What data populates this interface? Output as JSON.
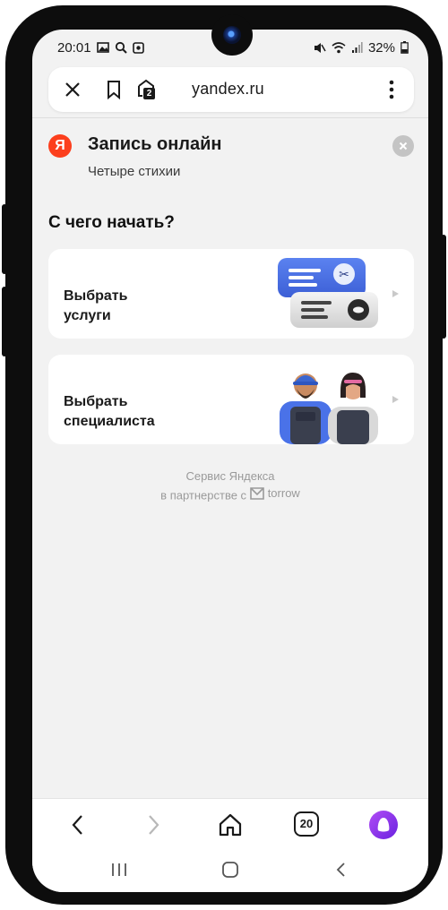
{
  "status_bar": {
    "time": "20:01",
    "battery": "32%",
    "icons_left": [
      "gallery-icon",
      "search-icon",
      "app-icon"
    ],
    "icons_right": [
      "mute-icon",
      "wifi-icon",
      "signal-icon",
      "battery-icon"
    ]
  },
  "browser": {
    "url": "yandex.ru",
    "tabs_badge": "2",
    "tabs_count": "20"
  },
  "header": {
    "logo_letter": "Я",
    "title": "Запись онлайн",
    "subtitle": "Четыре стихии"
  },
  "main": {
    "section_title": "С чего начать?",
    "cards": [
      {
        "line1": "Выбрать",
        "line2": "услуги"
      },
      {
        "line1": "Выбрать",
        "line2": "специалиста"
      }
    ]
  },
  "footer": {
    "line1": "Сервис Яндекса",
    "line2_prefix": "в партнерстве с",
    "partner": "torrow"
  },
  "colors": {
    "yandex_red": "#fc3f1d",
    "alice_purple": "#8a2be2",
    "service_card_blue": "#4a72e8"
  }
}
